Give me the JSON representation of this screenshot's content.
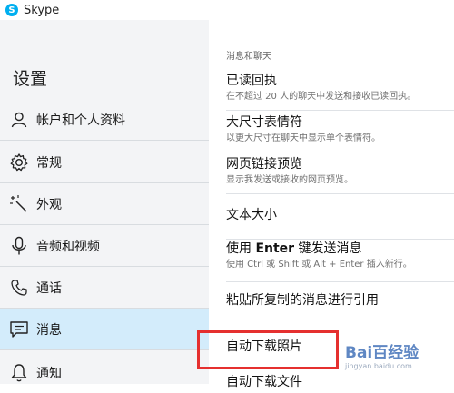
{
  "app": {
    "title": "Skype",
    "logo_letter": "S",
    "accent": "#00aff0"
  },
  "sidebar": {
    "heading": "设置",
    "items": [
      {
        "label": "帐户和个人资料",
        "icon": "user-icon"
      },
      {
        "label": "常规",
        "icon": "gear-icon"
      },
      {
        "label": "外观",
        "icon": "magic-wand-icon"
      },
      {
        "label": "音频和视频",
        "icon": "microphone-icon"
      },
      {
        "label": "通话",
        "icon": "phone-icon"
      },
      {
        "label": "消息",
        "icon": "message-icon",
        "active": true
      },
      {
        "label": "通知",
        "icon": "bell-icon"
      }
    ]
  },
  "main": {
    "section_title": "消息和聊天",
    "settings": [
      {
        "title": "已读回执",
        "desc": "在不超过 20 人的聊天中发送和接收已读回执。"
      },
      {
        "title": "大尺寸表情符",
        "desc": "以更大尺寸在聊天中显示单个表情符。"
      },
      {
        "title": "网页链接预览",
        "desc": "显示我发送或接收的网页预览。"
      },
      {
        "title": "文本大小",
        "desc": ""
      },
      {
        "title_prefix": "使用 ",
        "title_bold": "Enter",
        "title_suffix": " 键发送消息",
        "desc": "使用 Ctrl 或 Shift 或 Alt + Enter 插入新行。"
      },
      {
        "title": "粘贴所复制的消息进行引用",
        "desc": ""
      },
      {
        "title": "自动下载照片",
        "desc": ""
      },
      {
        "title": "自动下载文件",
        "desc": ""
      }
    ]
  },
  "watermark": {
    "main": "Bai百经验",
    "sub": "jingyan.baidu.com"
  }
}
